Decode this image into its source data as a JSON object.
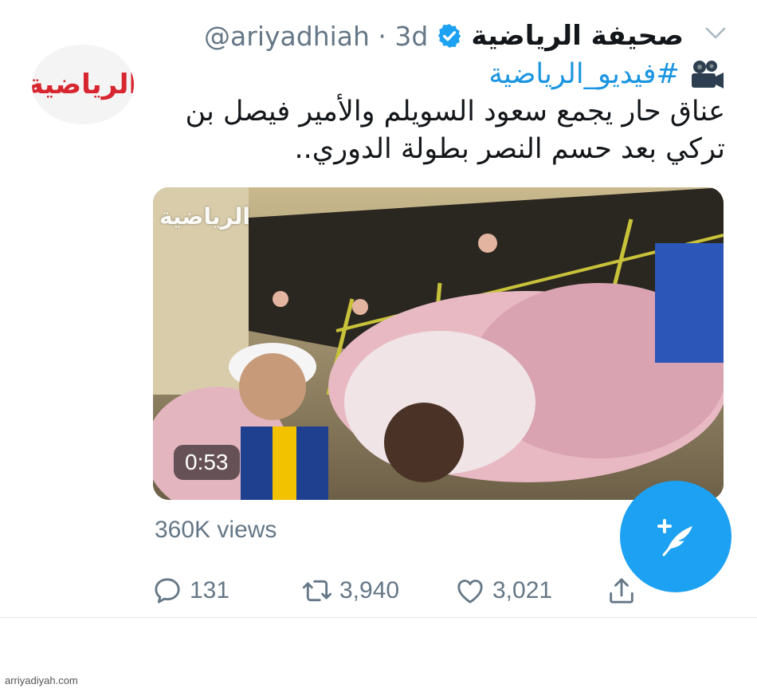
{
  "tweet": {
    "author_name": "صحيفة الرياضية",
    "handle": "@ariyadhiah",
    "separator": "·",
    "time": "3d",
    "avatar_text": "الرياضية",
    "hashtag": "#فيديو_الرياضية",
    "text_line_1": "عناق حار يجمع سعود السويلم والأمير فيصل بن",
    "text_line_2": "تركي بعد حسم النصر بطولة الدوري..",
    "video": {
      "watermark": "الرياضية",
      "duration": "0:53"
    },
    "views": "360K views",
    "actions": {
      "replies": "131",
      "retweets": "3,940",
      "likes": "3,021"
    }
  },
  "footer": {
    "site": "arriyadiyah.com"
  },
  "colors": {
    "accent": "#1da1f2",
    "link": "#1b95e0",
    "muted": "#657786",
    "brand_red": "#d7262f"
  }
}
